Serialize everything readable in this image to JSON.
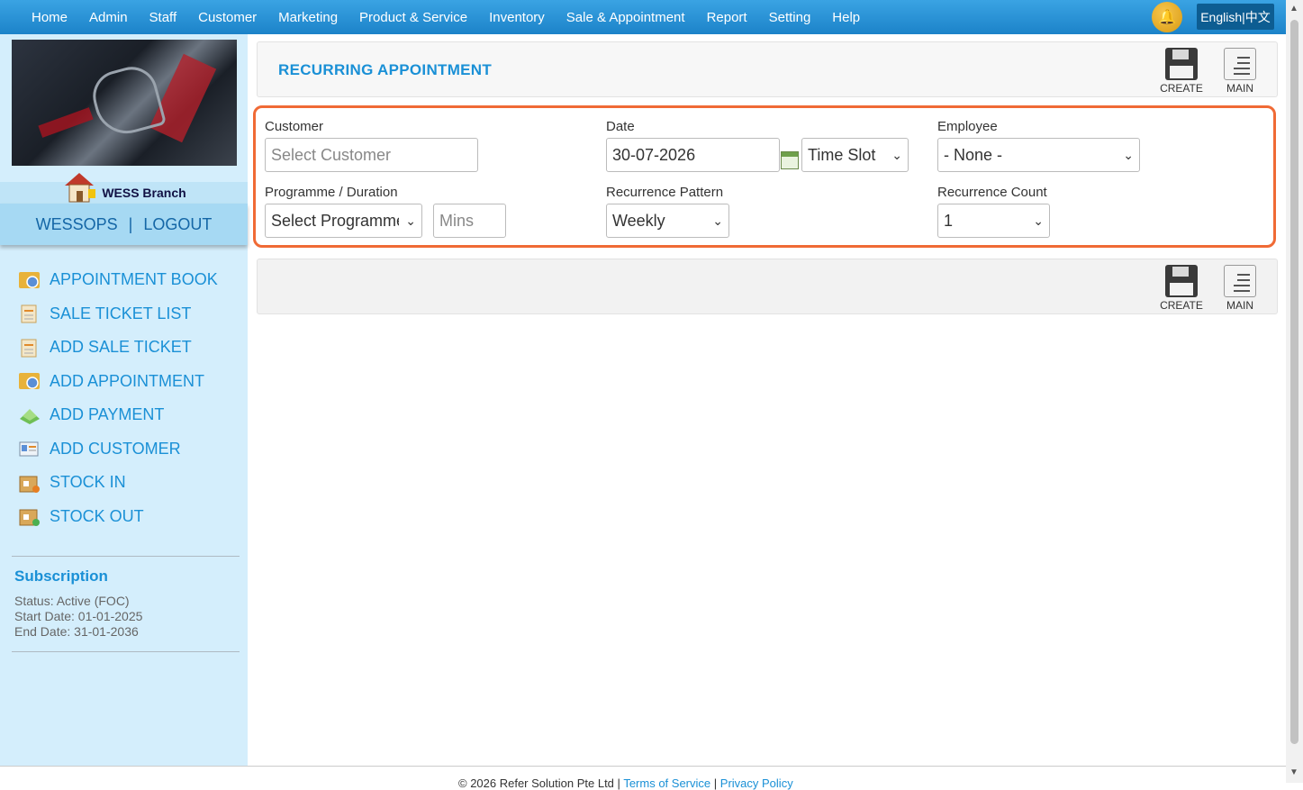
{
  "nav": {
    "items": [
      "Home",
      "Admin",
      "Staff",
      "Customer",
      "Marketing",
      "Product & Service",
      "Inventory",
      "Sale & Appointment",
      "Report",
      "Setting",
      "Help"
    ],
    "language": "English|中文"
  },
  "sidebar": {
    "branch": "WESS Branch",
    "user": "WESSOPS",
    "separator": "|",
    "logout": "LOGOUT",
    "menu": [
      {
        "label": "APPOINTMENT BOOK",
        "icon": "appointment-book-icon"
      },
      {
        "label": "SALE TICKET LIST",
        "icon": "sale-ticket-icon"
      },
      {
        "label": "ADD SALE TICKET",
        "icon": "sale-ticket-icon"
      },
      {
        "label": "ADD APPOINTMENT",
        "icon": "appointment-book-icon"
      },
      {
        "label": "ADD PAYMENT",
        "icon": "payment-icon"
      },
      {
        "label": "ADD CUSTOMER",
        "icon": "customer-card-icon"
      },
      {
        "label": "STOCK IN",
        "icon": "stock-box-icon"
      },
      {
        "label": "STOCK OUT",
        "icon": "stock-box-icon"
      }
    ],
    "subscription": {
      "title": "Subscription",
      "status": "Status: Active (FOC)",
      "start": "Start Date: 01-01-2025",
      "end": "End Date: 31-01-2036"
    }
  },
  "page": {
    "title": "RECURRING APPOINTMENT",
    "create_label": "CREATE",
    "main_label": "MAIN"
  },
  "form": {
    "customer_label": "Customer",
    "customer_placeholder": "Select Customer",
    "date_label": "Date",
    "date_value": "30-07-2026",
    "timeslot_value": "Time Slot",
    "employee_label": "Employee",
    "employee_value": "- None -",
    "programme_label": "Programme / Duration",
    "programme_value": "Select Programme",
    "mins_placeholder": "Mins",
    "pattern_label": "Recurrence Pattern",
    "pattern_value": "Weekly",
    "count_label": "Recurrence Count",
    "count_value": "1"
  },
  "footer": {
    "copyright": "© 2026 Refer Solution Pte Ltd",
    "sep": "|",
    "terms": "Terms of Service",
    "privacy": "Privacy Policy"
  },
  "colors": {
    "accent": "#1a90d6",
    "highlight_border": "#f06a35",
    "nav_bg": "#1c83c9",
    "sidebar_bg": "#d4eefc"
  }
}
